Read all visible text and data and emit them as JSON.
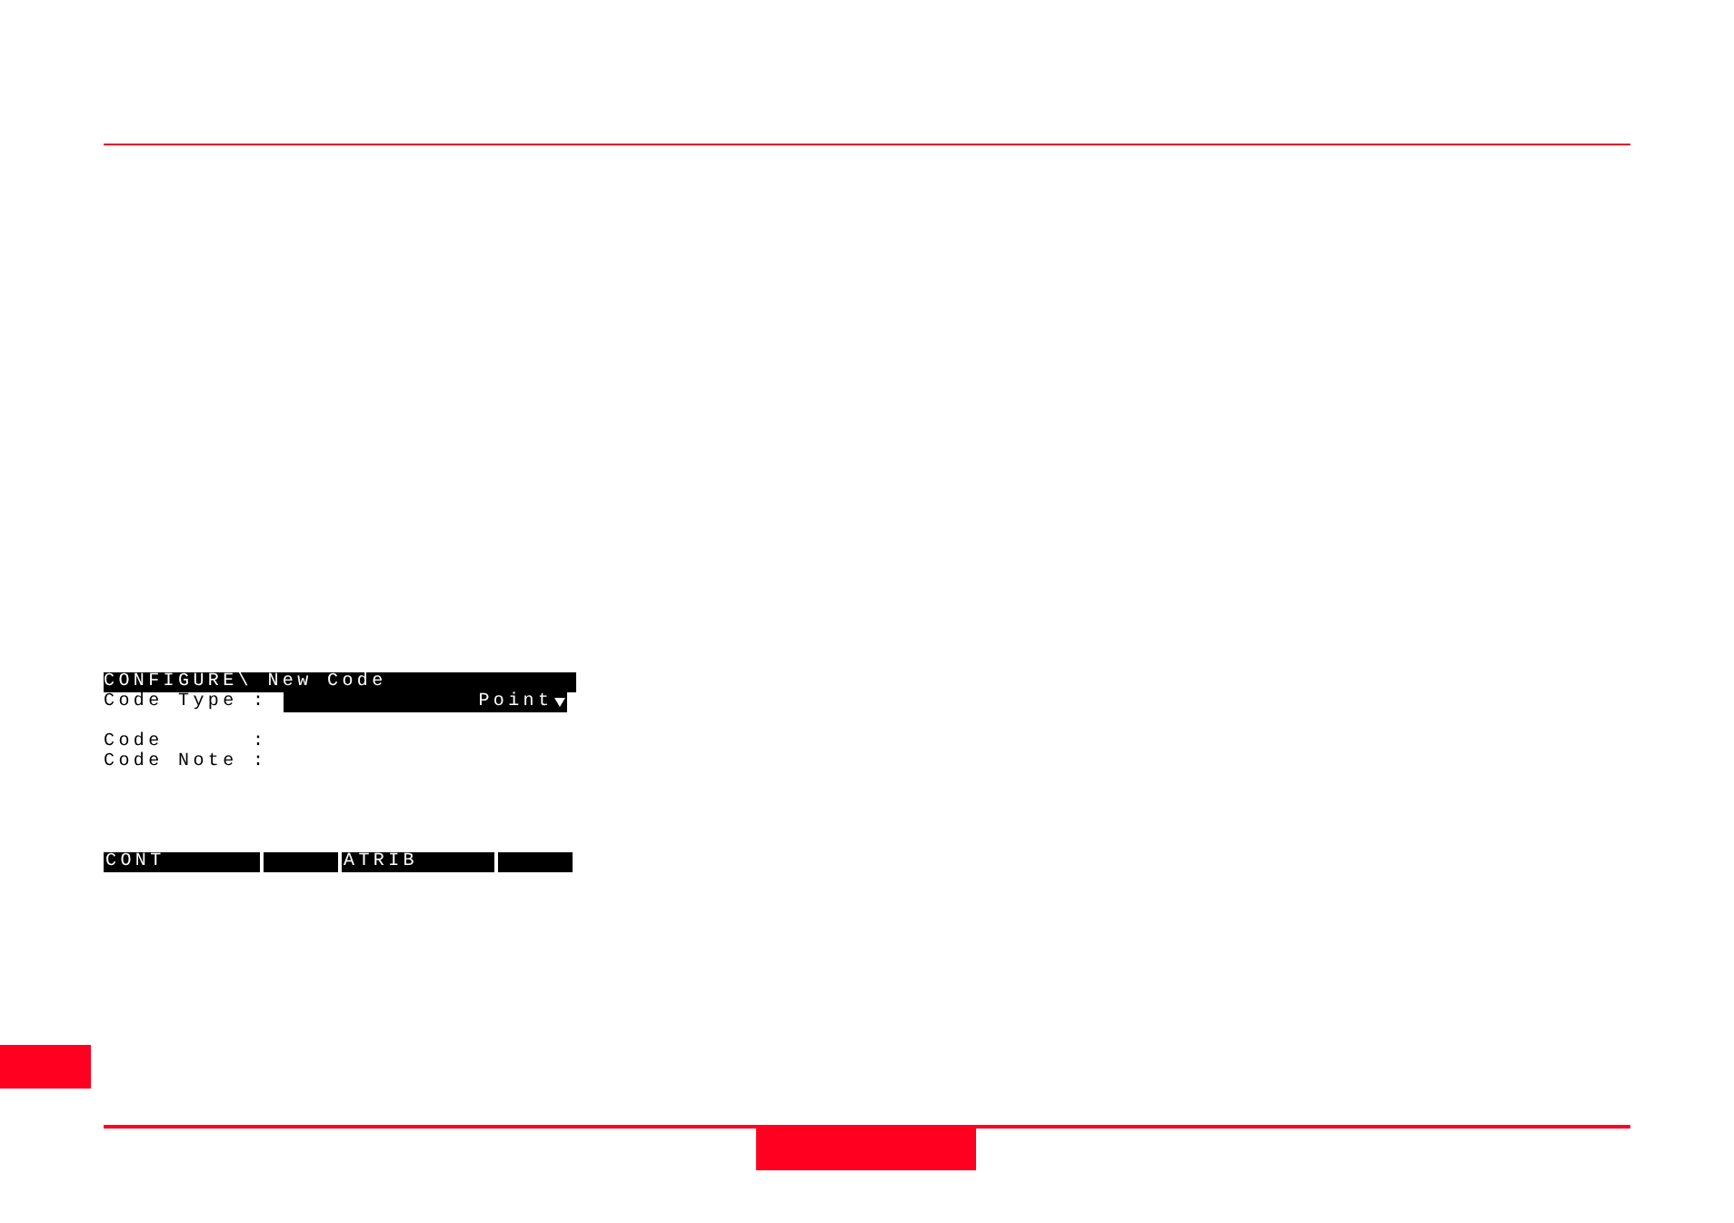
{
  "screen": {
    "title": "CONFIGURE\\ New Code",
    "fields": [
      {
        "kind": "select",
        "label": "Code Type",
        "separator": ":",
        "value": "Point"
      },
      {
        "kind": "input",
        "label": "Code",
        "separator": ":"
      },
      {
        "kind": "input",
        "label": "Code Note",
        "separator": ":"
      }
    ],
    "softkeys": [
      {
        "kind": "label",
        "label": "CONT"
      },
      {
        "kind": "blank"
      },
      {
        "kind": "label",
        "label": "ATRIB"
      },
      {
        "kind": "blank"
      }
    ]
  }
}
